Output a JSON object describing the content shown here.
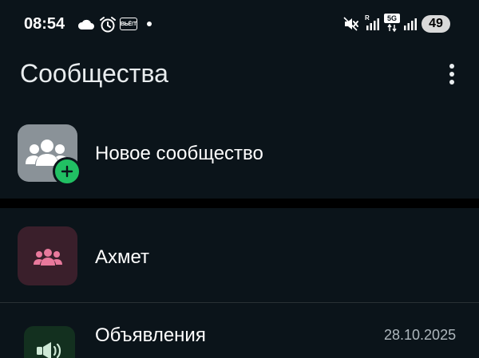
{
  "status_bar": {
    "time": "08:54",
    "badge_text": "ВЬЁ!Т",
    "network_5g": "5G",
    "roaming": "R",
    "battery": "49"
  },
  "header": {
    "title": "Сообщества"
  },
  "new_community": {
    "label": "Новое сообщество"
  },
  "communities": [
    {
      "name": "Ахмет"
    }
  ],
  "announcements": {
    "title": "Объявления",
    "date": "28.10.2025"
  },
  "colors": {
    "background": "#0b141a",
    "accent_green": "#21c063",
    "avatar_gray": "#8a9298",
    "community_pink": "#e8799c",
    "community_bg": "#3a1f2b",
    "announce_green": "#cfe9d6"
  }
}
